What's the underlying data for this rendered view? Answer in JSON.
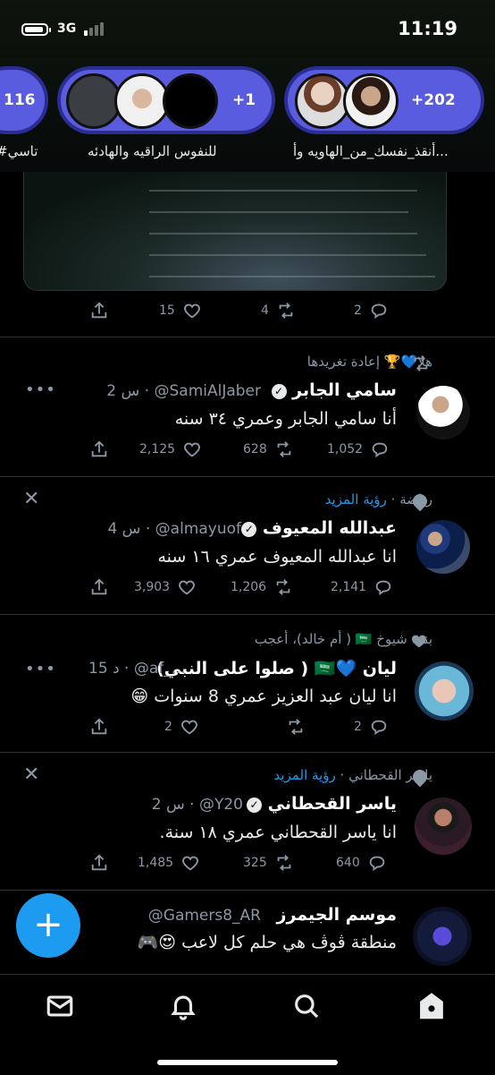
{
  "status": {
    "time": "11:19",
    "network": "3G",
    "battery_level": 0.9
  },
  "fleets": [
    {
      "count": "+202",
      "label": "أنقذ_نفسك_من_الهاويه وأ..."
    },
    {
      "count": "+1",
      "label": "للنفوس الراقيه والهادئه"
    },
    {
      "count": "116",
      "label": "#تاسي"
    }
  ],
  "top_tweet_actions": {
    "likes": "15",
    "retweets": "4",
    "replies": "2"
  },
  "tweets": [
    {
      "context": "هلا💙🏆 إعادة تغريدها",
      "name": "سامي الجابر",
      "handle": "@SamiAlJaber",
      "time": "2 س",
      "text": "أنا سامي الجابر وعمري ٣٤ سنه",
      "likes": "2,125",
      "retweets": "628",
      "replies": "1,052"
    },
    {
      "context_topic": "رياضة",
      "context_link": "رؤية المزيد",
      "name": "عبدالله المعيوف",
      "handle": "@almayuof",
      "time": "4 س",
      "text": "انا عبدالله المعيوف عمري  ١٦ سنه",
      "likes": "3,903",
      "retweets": "1,206",
      "replies": "2,141"
    },
    {
      "context": "بنت شيوخ 🇸🇦 ( أم خالد)، أعجب",
      "name": "ليان 💙🇸🇦 ( صلوا على النبي)",
      "handle": "@af_...",
      "time": "15 د",
      "text": "انا ليان عبد العزيز عمري 8 سنوات 😁",
      "likes": "2",
      "retweets": "",
      "replies": "2"
    },
    {
      "context_topic": "ياسر القحطاني",
      "context_link": "رؤية المزيد",
      "name": "ياسر القحطاني",
      "handle": "@Y20",
      "time": "2 س",
      "text": "انا ياسر القحطاني عمري ١٨ سنة.",
      "likes": "1,485",
      "retweets": "325",
      "replies": "640"
    },
    {
      "name": "موسم الجيمرز",
      "handle": "@Gamers8_AR",
      "text": "منطقة ڤوڤ هي حلم كل لاعب 😍🎮"
    }
  ],
  "colors": {
    "accent": "#1d9bf0",
    "fleet": "#5a5ce0",
    "muted": "#8b98a5"
  },
  "tabs": [
    "messages-icon",
    "notifications-icon",
    "search-icon",
    "home-icon"
  ]
}
